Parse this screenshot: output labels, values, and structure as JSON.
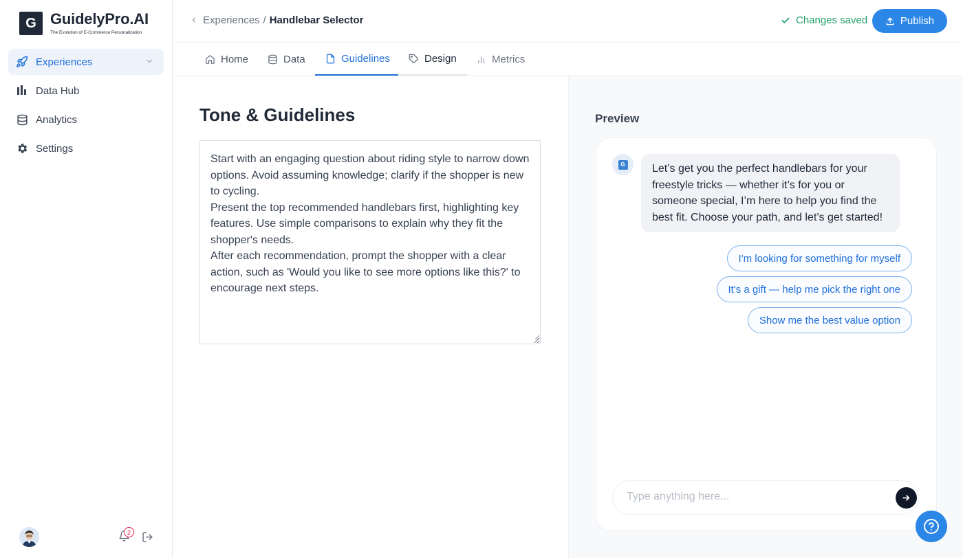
{
  "brand": {
    "mark": "G",
    "name": "GuidelyPro.AI",
    "tagline": "The Evolution of E-Commerce Personalization"
  },
  "sidebar": {
    "items": [
      {
        "label": "Experiences",
        "icon": "rocket-icon",
        "active": true
      },
      {
        "label": "Data Hub",
        "icon": "bar-chart-icon"
      },
      {
        "label": "Analytics",
        "icon": "database-icon"
      },
      {
        "label": "Settings",
        "icon": "gear-icon"
      }
    ],
    "notifications_count": "2"
  },
  "header": {
    "breadcrumb_parent": "Experiences",
    "breadcrumb_sep": "/",
    "breadcrumb_current": "Handlebar Selector",
    "status": "Changes saved",
    "publish_label": "Publish"
  },
  "tabs": [
    {
      "label": "Home",
      "icon": "home-icon"
    },
    {
      "label": "Data",
      "icon": "database-icon"
    },
    {
      "label": "Guidelines",
      "icon": "document-icon",
      "active": true
    },
    {
      "label": "Design",
      "icon": "tag-icon"
    },
    {
      "label": "Metrics",
      "icon": "bar-chart-icon"
    }
  ],
  "editor": {
    "title": "Tone & Guidelines",
    "text": "Start with an engaging question about riding style to narrow down options. Avoid assuming knowledge; clarify if the shopper is new to cycling.\nPresent the top recommended handlebars first, highlighting key features. Use simple comparisons to explain why they fit the shopper's needs.\nAfter each recommendation, prompt the shopper with a clear action, such as 'Would you like to see more options like this?' to encourage next steps."
  },
  "preview": {
    "label": "Preview",
    "bot_avatar": "G",
    "message": "Let’s get you the perfect handlebars for your freestyle tricks — whether it’s for you or someone special, I’m here to help you find the best fit. Choose your path, and let’s get started!",
    "options": [
      "I'm looking for something for myself",
      "It's a gift — help me pick the right one",
      "Show me the best value option"
    ],
    "input_placeholder": "Type anything here..."
  },
  "colors": {
    "accent": "#2b86e6",
    "active_nav_bg": "#eef3fb",
    "saved_green": "#22a06b",
    "text": "#1f2937"
  }
}
